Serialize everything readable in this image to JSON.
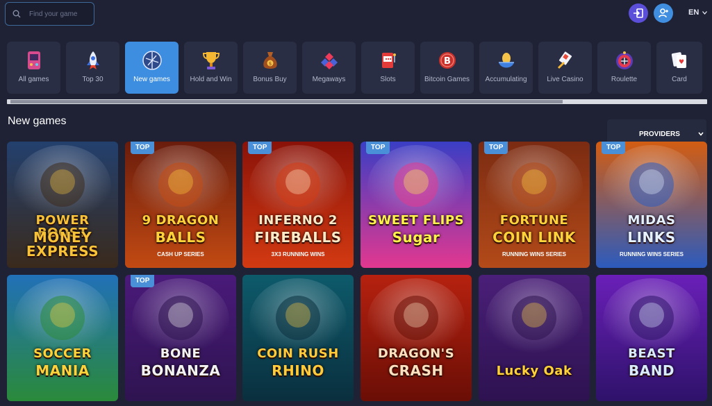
{
  "search": {
    "placeholder": "Find your game"
  },
  "header": {
    "language": "EN"
  },
  "categories": [
    {
      "label": "All games",
      "icon": "joystick-icon",
      "active": false
    },
    {
      "label": "Top 30",
      "icon": "rocket-icon",
      "active": false
    },
    {
      "label": "New games",
      "icon": "new-ball-icon",
      "active": true
    },
    {
      "label": "Hold and Win",
      "icon": "trophy-icon",
      "active": false
    },
    {
      "label": "Bonus Buy",
      "icon": "money-bag-icon",
      "active": false
    },
    {
      "label": "Megaways",
      "icon": "megaways-icon",
      "active": false
    },
    {
      "label": "Slots",
      "icon": "slot-machine-icon",
      "active": false
    },
    {
      "label": "Bitcoin Games",
      "icon": "bitcoin-icon",
      "active": false
    },
    {
      "label": "Accumulating",
      "icon": "egg-icon",
      "active": false
    },
    {
      "label": "Live Casino",
      "icon": "live-casino-icon",
      "active": false
    },
    {
      "label": "Roulette",
      "icon": "roulette-icon",
      "active": false
    },
    {
      "label": "Card",
      "icon": "cards-icon",
      "active": false
    }
  ],
  "section": {
    "title": "New games",
    "providers_label": "PROVIDERS"
  },
  "badge_label": "TOP",
  "games": [
    {
      "name": "POWER BOOST",
      "name2": "MONEY EXPRESS",
      "top": false,
      "colors": [
        "#23406e",
        "#3a2a1c"
      ],
      "text_color": "#f7c238"
    },
    {
      "name": "9 DRAGON",
      "name2": "BALLS",
      "sub": "CASH UP SERIES",
      "top": true,
      "colors": [
        "#6a1c0c",
        "#c24a13"
      ],
      "text_color": "#ffd23a"
    },
    {
      "name": "INFERNO 2",
      "name2": "FIREBALLS",
      "sub": "3X3 RUNNING WINS",
      "top": true,
      "colors": [
        "#8a1208",
        "#d33a12"
      ],
      "text_color": "#ffe9c7"
    },
    {
      "name": "SWEET FLIPS",
      "name2": "Sugar",
      "top": true,
      "colors": [
        "#3a3ec5",
        "#e2388f"
      ],
      "text_color": "#fff24a"
    },
    {
      "name": "FORTUNE",
      "name2": "COIN LINK",
      "sub": "RUNNING WINS SERIES",
      "top": true,
      "colors": [
        "#7b2b12",
        "#b34a19"
      ],
      "text_color": "#ffd23a"
    },
    {
      "name": "MIDAS",
      "name2": "LINKS",
      "sub": "RUNNING WINS SERIES",
      "top": true,
      "colors": [
        "#d35d12",
        "#2c5bbd"
      ],
      "text_color": "#e5f1ff"
    },
    {
      "name": "SOCCER",
      "name2": "MANIA",
      "top": false,
      "colors": [
        "#2170b8",
        "#2a8a3a"
      ],
      "text_color": "#ffd23a"
    },
    {
      "name": "BONE",
      "name2": "BONANZA",
      "top": true,
      "colors": [
        "#4a1a7a",
        "#2e1450"
      ],
      "text_color": "#f2f2f2"
    },
    {
      "name": "COIN RUSH",
      "name2": "RHINO",
      "top": false,
      "colors": [
        "#0d5a6b",
        "#0a2f3e"
      ],
      "text_color": "#ffcb3a"
    },
    {
      "name": "DRAGON'S",
      "name2": "CRASH",
      "top": false,
      "colors": [
        "#b6210f",
        "#6a0e06"
      ],
      "text_color": "#ffe1c0"
    },
    {
      "name": "Lucky Oak",
      "name2": "",
      "top": false,
      "colors": [
        "#4a1f78",
        "#2d1250"
      ],
      "text_color": "#ffd23a"
    },
    {
      "name": "BEAST",
      "name2": "BAND",
      "top": false,
      "colors": [
        "#6a1fb8",
        "#2e126a"
      ],
      "text_color": "#d9ecff"
    }
  ]
}
